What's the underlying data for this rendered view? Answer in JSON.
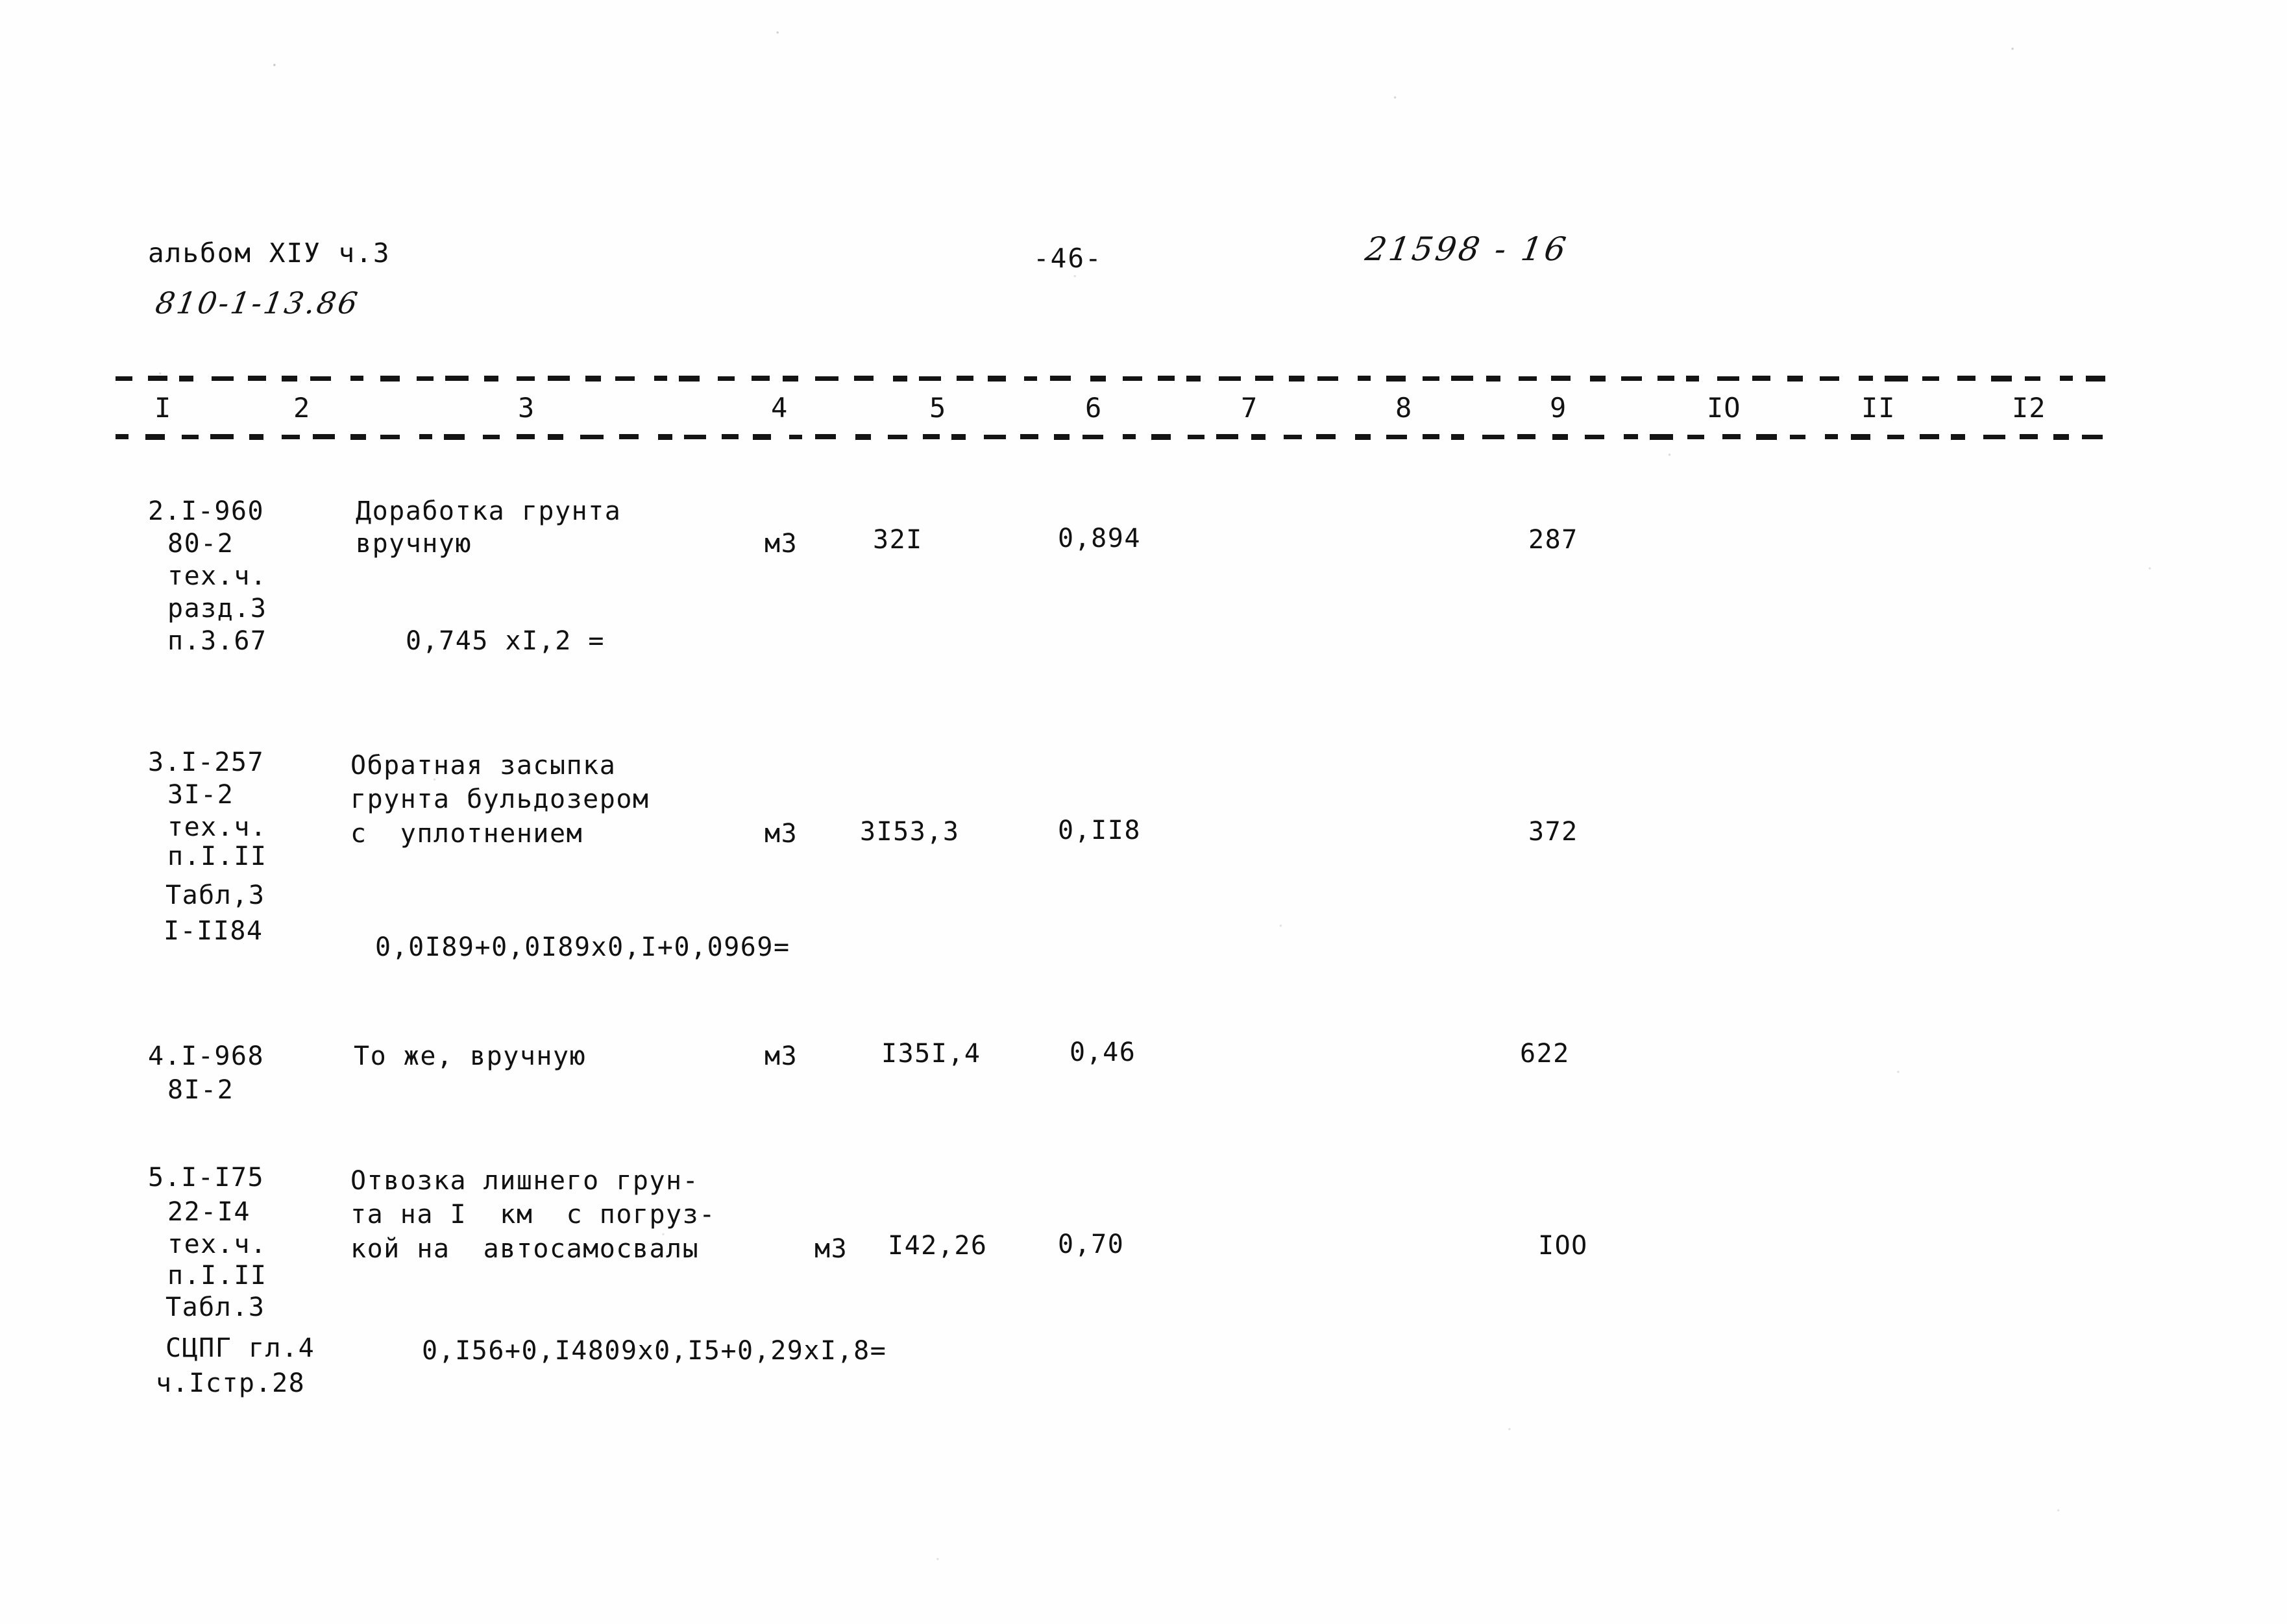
{
  "document": {
    "album_line": "альбом XIУ ч.3",
    "album_code": "810-1-13.86",
    "page_number": "-46-",
    "doc_number": "21598 - 16"
  },
  "table": {
    "column_numbers": [
      "I",
      "2",
      "3",
      "4",
      "5",
      "6",
      "7",
      "8",
      "9",
      "IO",
      "II",
      "I2"
    ],
    "rows": [
      {
        "index": "2.I-960",
        "code_lines": [
          "2.I-960",
          "80-2",
          "тех.ч.",
          "разд.3",
          "п.3.67"
        ],
        "description_lines": [
          "Доработка грунта",
          "вручную"
        ],
        "unit": "м3",
        "quantity": "32I",
        "norm": "0,894",
        "total": "287",
        "formula": "0,745 xI,2 ="
      },
      {
        "index": "3.I-257",
        "code_lines": [
          "3.I-257",
          "3I-2",
          "тех.ч.",
          "п.I.II",
          "Табл,3",
          "I-II84"
        ],
        "description_lines": [
          "Обратная засыпка",
          "грунта бульдозером",
          "с  уплотнением"
        ],
        "unit": "м3",
        "quantity": "3I53,3",
        "norm": "0,II8",
        "total": "372",
        "formula": "0,0I89+0,0I89x0,I+0,0969="
      },
      {
        "index": "4.I-968",
        "code_lines": [
          "4.I-968",
          "8I-2"
        ],
        "description_lines": [
          "То же, вручную"
        ],
        "unit": "м3",
        "quantity": "I35I,4",
        "norm": "0,46",
        "total": "622",
        "formula": ""
      },
      {
        "index": "5.I-I75",
        "code_lines": [
          "5.I-I75",
          "22-I4",
          "тех.ч.",
          "п.I.II",
          "Табл.3",
          "СЦПГ гл.4",
          "ч.Iстр.28"
        ],
        "description_lines": [
          "Отвозка лишнего грун-",
          "та на I  км  с погруз-",
          "кой на  автосамосвалы"
        ],
        "unit": "м3",
        "quantity": "I42,26",
        "norm": "0,70",
        "total": "IOO",
        "formula": "0,I56+0,I4809x0,I5+0,29xI,8="
      }
    ]
  },
  "colors": {
    "ink": "#111111",
    "paper": "#fefefe"
  }
}
